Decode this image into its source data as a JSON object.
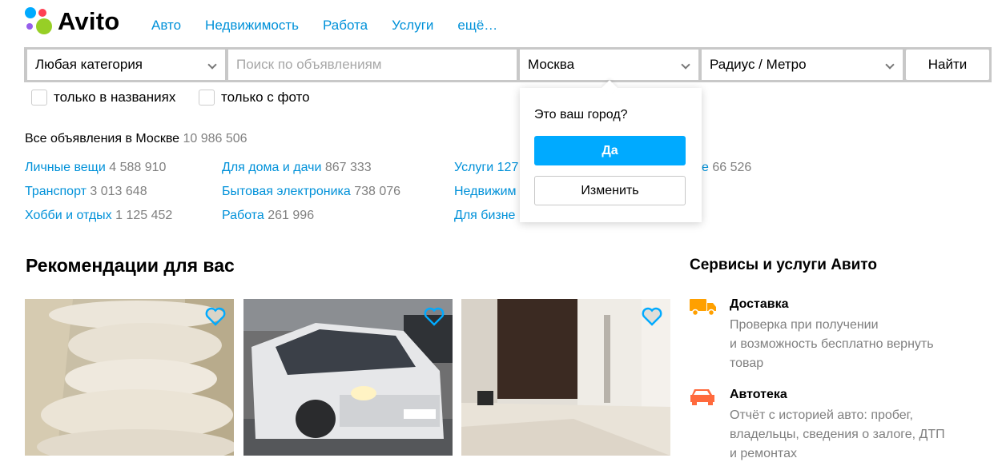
{
  "logo": {
    "text": "Avito",
    "dot_colors": [
      "#00aaff",
      "#ff4053",
      "#965eeb",
      "#97cf26"
    ]
  },
  "nav": [
    "Авто",
    "Недвижимость",
    "Работа",
    "Услуги",
    "ещё…"
  ],
  "search": {
    "category": "Любая категория",
    "placeholder": "Поиск по объявлениям",
    "city": "Москва",
    "radius": "Радиус / Метро",
    "button": "Найти"
  },
  "filters": {
    "titles_only": "только в названиях",
    "with_photo": "только с фото"
  },
  "all_ads": {
    "label": "Все объявления в Москве",
    "count": "10 986 506"
  },
  "categories": [
    {
      "name": "Личные вещи",
      "count": "4 588 910"
    },
    {
      "name": "Транспорт",
      "count": "3 013 648"
    },
    {
      "name": "Хобби и отдых",
      "count": "1 125 452"
    },
    {
      "name": "Для дома и дачи",
      "count": "867 333"
    },
    {
      "name": "Бытовая электроника",
      "count": "738 076"
    },
    {
      "name": "Работа",
      "count": "261 996"
    },
    {
      "name": "Услуги 127",
      "count": ""
    },
    {
      "name": "Недвижим",
      "count": ""
    },
    {
      "name": "Для бизне",
      "count": ""
    },
    {
      "name": "е",
      "count": "66 526"
    }
  ],
  "popup": {
    "title": "Это ваш город?",
    "yes": "Да",
    "change": "Изменить"
  },
  "recommendations": {
    "title": "Рекомендации для вас",
    "cards": [
      {
        "image": "pillows-photo",
        "favorite_icon": "heart-icon"
      },
      {
        "image": "white-car-photo",
        "favorite_icon": "heart-icon"
      },
      {
        "image": "hallway-door-photo",
        "favorite_icon": "heart-icon"
      }
    ]
  },
  "services": {
    "title": "Сервисы и услуги Авито",
    "items": [
      {
        "icon": "delivery-truck-icon",
        "title": "Доставка",
        "desc": [
          "Проверка при получении",
          "и возможность бесплатно вернуть",
          "товар"
        ]
      },
      {
        "icon": "car-report-icon",
        "title": "Автотека",
        "desc": [
          "Отчёт с историей авто: пробег,",
          "владельцы, сведения о залоге, ДТП",
          "и ремонтах"
        ]
      }
    ]
  },
  "colors": {
    "link": "#0091d9",
    "primary_button": "#00aaff",
    "muted": "#7f7f7f",
    "icon_orange": "#ffa000",
    "icon_red": "#ff6a3d"
  }
}
